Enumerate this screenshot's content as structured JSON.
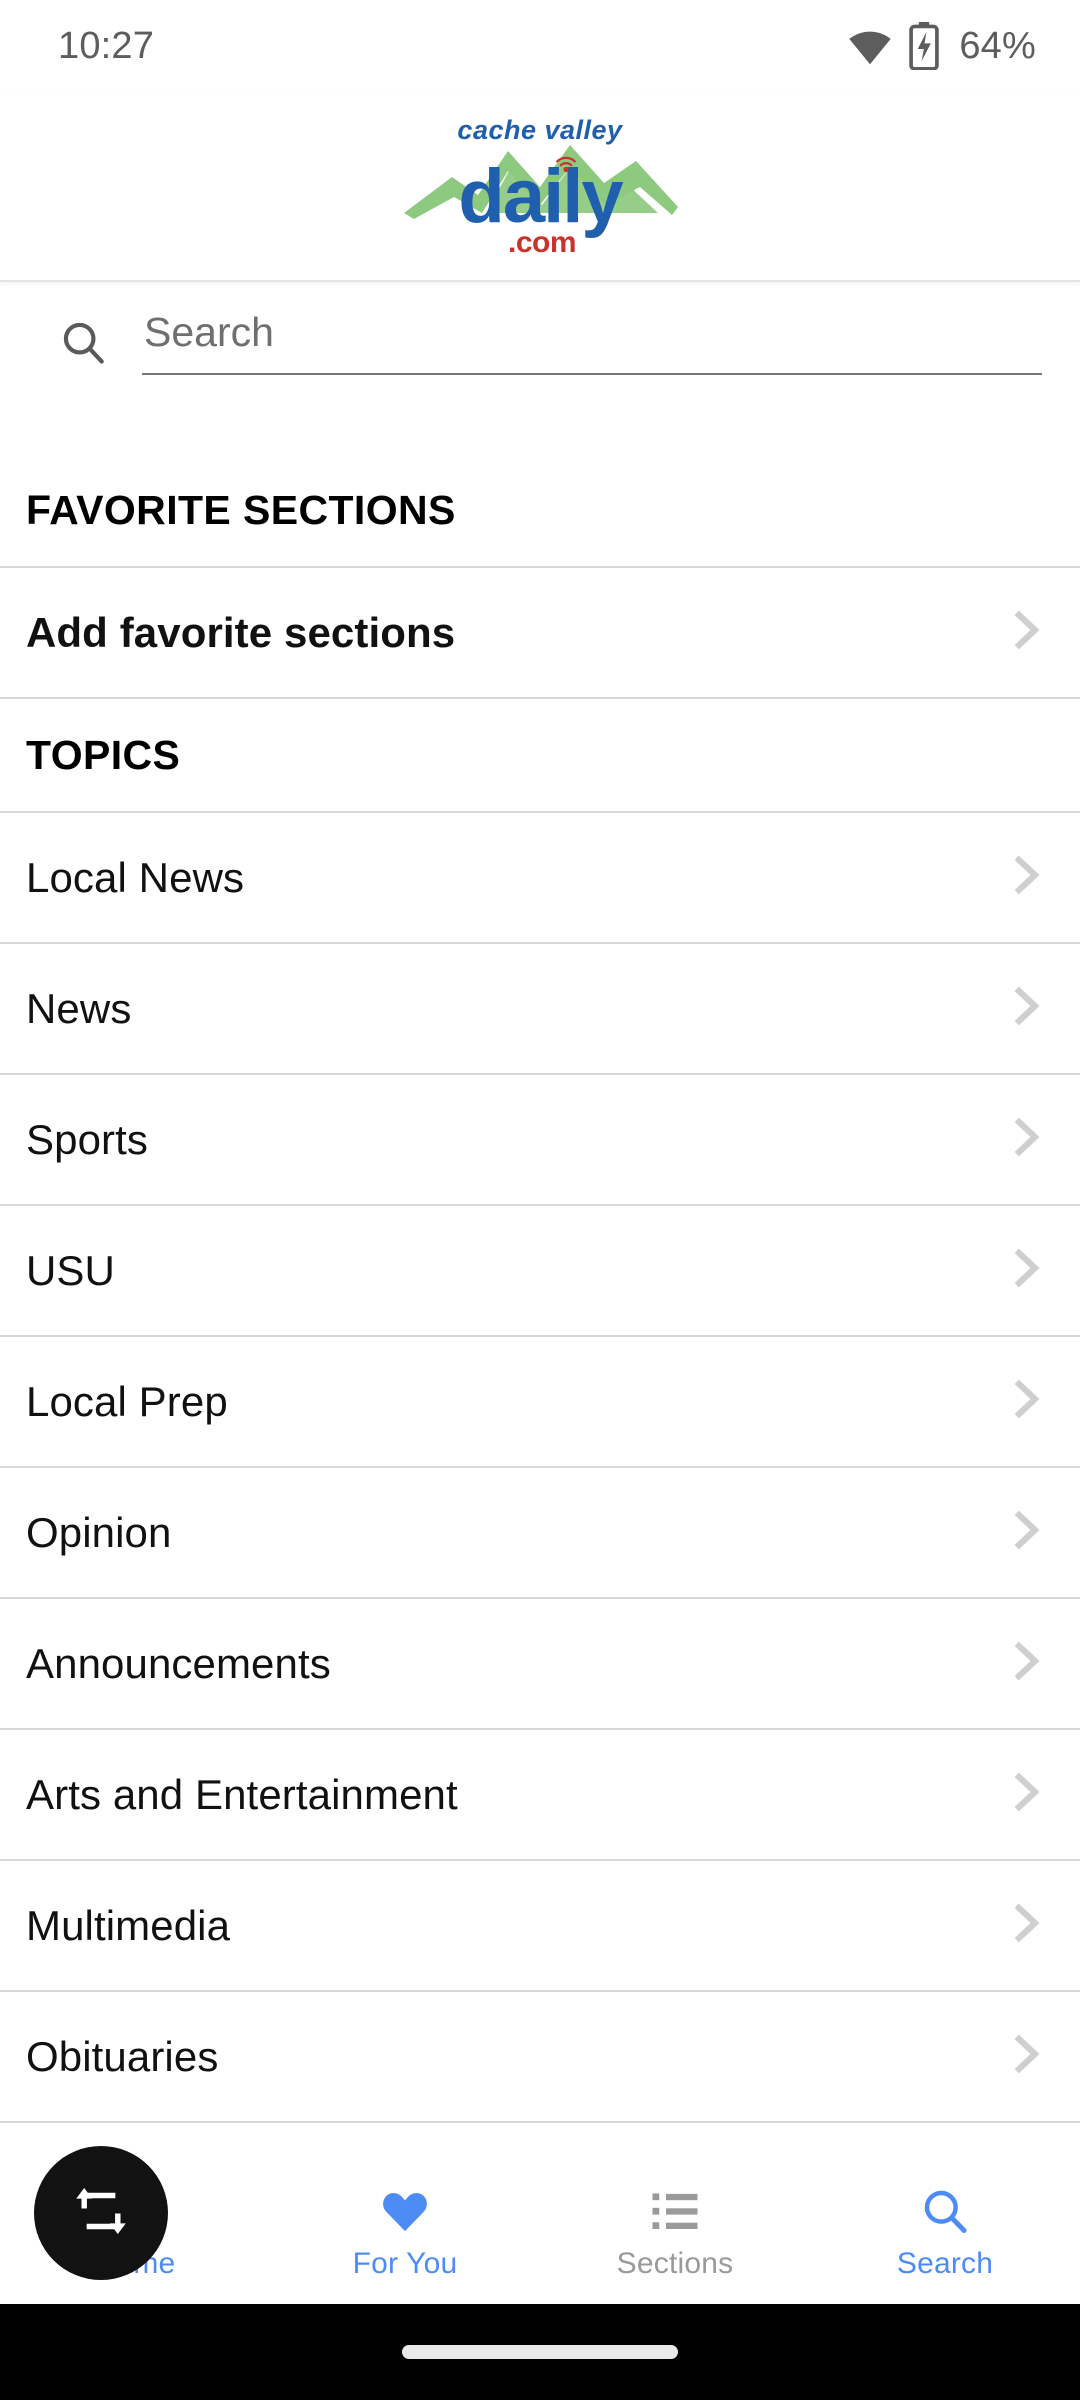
{
  "status_bar": {
    "time": "10:27",
    "battery_percent": "64%",
    "wifi_icon": "wifi-icon",
    "battery_icon": "battery-charging-icon"
  },
  "header": {
    "logo_alt": "cache valley daily .com",
    "logo_line1": "cache valley",
    "logo_line2": "daily",
    "logo_line3": ".com",
    "colors": {
      "blue": "#1F5FAE",
      "green": "#8DC97E",
      "red": "#C9332B"
    }
  },
  "search": {
    "placeholder": "Search",
    "value": "",
    "icon": "search-icon"
  },
  "sections": [
    {
      "header": "FAVORITE SECTIONS",
      "items": [
        {
          "label": "Add favorite sections",
          "bold": true,
          "chevron": "chevron-right-icon"
        }
      ]
    },
    {
      "header": "TOPICS",
      "items": [
        {
          "label": "Local News",
          "bold": false,
          "chevron": "chevron-right-icon"
        },
        {
          "label": "News",
          "bold": false,
          "chevron": "chevron-right-icon"
        },
        {
          "label": "Sports",
          "bold": false,
          "chevron": "chevron-right-icon"
        },
        {
          "label": "USU",
          "bold": false,
          "chevron": "chevron-right-icon"
        },
        {
          "label": "Local Prep",
          "bold": false,
          "chevron": "chevron-right-icon"
        },
        {
          "label": "Opinion",
          "bold": false,
          "chevron": "chevron-right-icon"
        },
        {
          "label": "Announcements",
          "bold": false,
          "chevron": "chevron-right-icon"
        },
        {
          "label": "Arts and Entertainment",
          "bold": false,
          "chevron": "chevron-right-icon"
        },
        {
          "label": "Multimedia",
          "bold": false,
          "chevron": "chevron-right-icon"
        },
        {
          "label": "Obituaries",
          "bold": false,
          "chevron": "chevron-right-icon"
        }
      ]
    }
  ],
  "bottom_nav": {
    "accent_color": "#4e8cf5",
    "inactive_color": "#9a9a9a",
    "items": [
      {
        "label": "Home",
        "icon": "home-icon",
        "active": true
      },
      {
        "label": "For You",
        "icon": "heart-icon",
        "active": true
      },
      {
        "label": "Sections",
        "icon": "list-icon",
        "active": false
      },
      {
        "label": "Search",
        "icon": "search-icon",
        "active": true
      }
    ]
  },
  "fab": {
    "icon": "repeat-icon",
    "background": "#121212"
  },
  "gesture_bar": {
    "handle": "home-indicator"
  }
}
